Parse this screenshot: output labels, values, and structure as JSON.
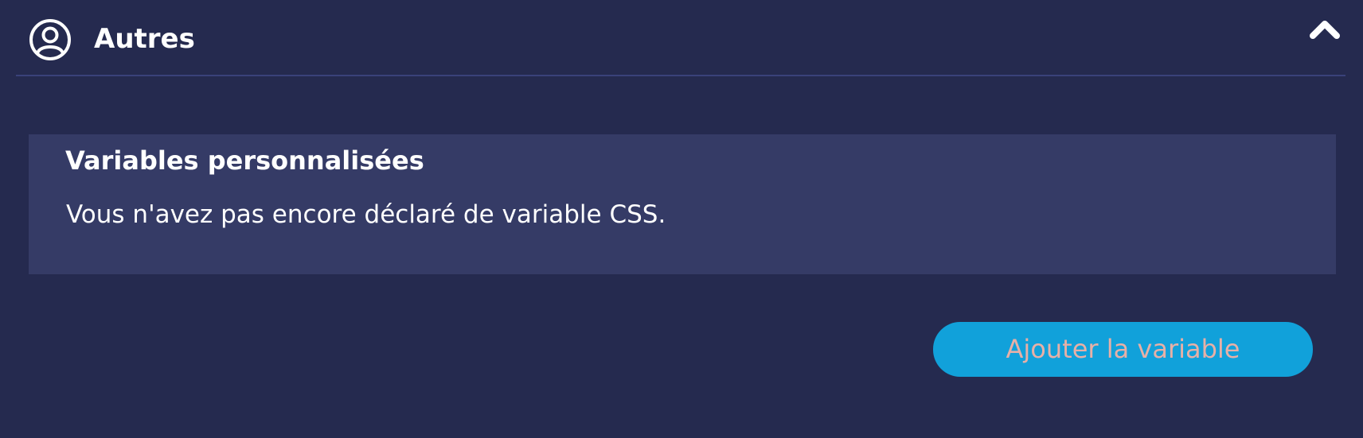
{
  "section": {
    "title": "Autres",
    "icon": "user-circle-icon",
    "collapse_icon": "chevron-up-icon"
  },
  "custom_variables": {
    "title": "Variables personnalisées",
    "message": "Vous n'avez pas encore déclaré de variable CSS."
  },
  "actions": {
    "add_variable_label": "Ajouter la variable"
  },
  "colors": {
    "background": "#252a4f",
    "card": "#353b66",
    "divider": "#3a427a",
    "button": "#11a1da",
    "button_text": "#e7b0a7",
    "text": "#ffffff"
  }
}
